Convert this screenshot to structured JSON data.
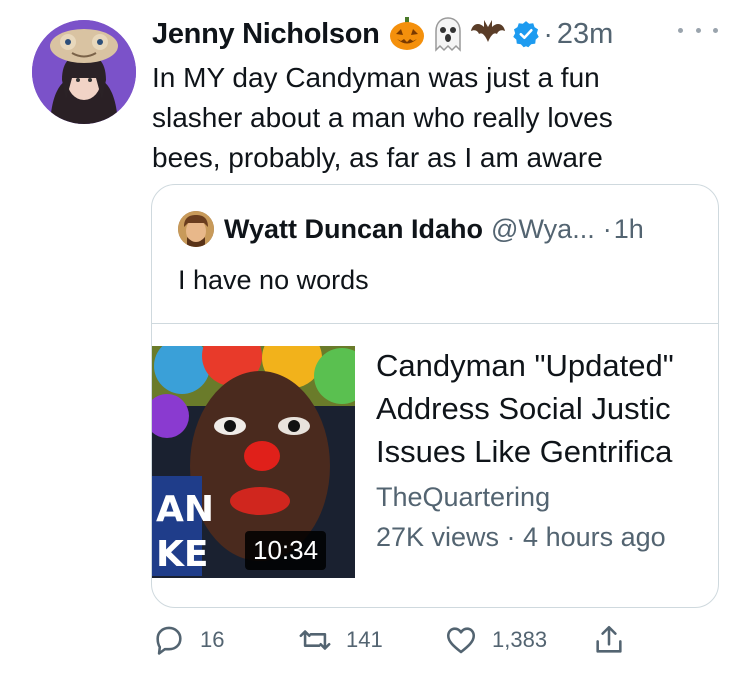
{
  "tweet": {
    "author_name": "Jenny Nicholson",
    "emoji_icons": [
      "jack-o-lantern-icon",
      "ghost-icon",
      "bat-icon"
    ],
    "verified_icon": "verified-badge-icon",
    "separator": "·",
    "time": "23m",
    "text": "In MY day Candyman was just a fun slasher about a man who really loves bees, probably, as far as I am aware"
  },
  "quoted": {
    "author_name": "Wyatt Duncan Idaho",
    "handle": "@Wya...",
    "separator": "·",
    "time": "1h",
    "text": "I have no words",
    "video_card": {
      "title_lines": [
        "Candyman \"Updated\"",
        "Address Social Justic",
        "Issues Like Gentrifica"
      ],
      "thumbnail_text": "AN KE",
      "duration": "10:34",
      "channel": "TheQuartering",
      "meta": "27K views · 4 hours ago"
    }
  },
  "actions": {
    "replies": "16",
    "retweets": "141",
    "likes": "1,383"
  },
  "colors": {
    "text_primary": "#0f1419",
    "text_secondary": "#536471",
    "verified_blue": "#1d9bf0",
    "border": "#cfd9de"
  }
}
